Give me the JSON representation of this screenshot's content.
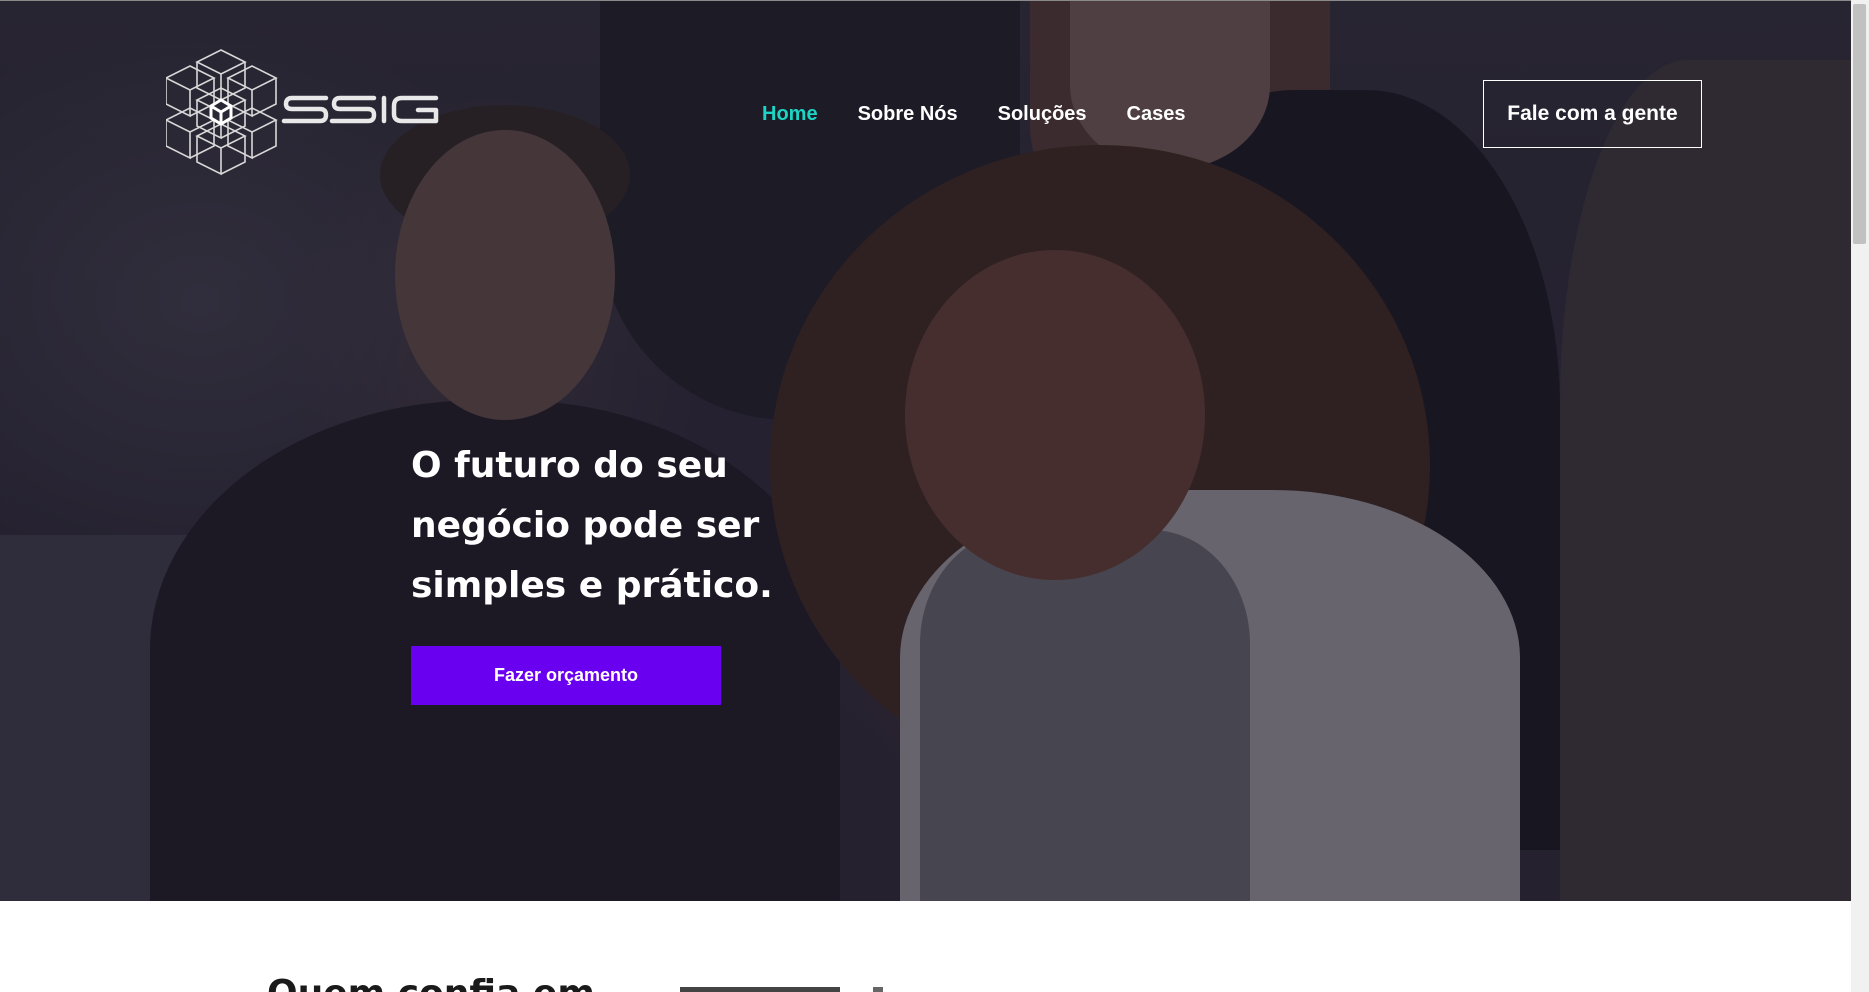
{
  "brand": {
    "name": "SSIG"
  },
  "nav": {
    "items": [
      {
        "label": "Home",
        "active": true
      },
      {
        "label": "Sobre Nós",
        "active": false
      },
      {
        "label": "Soluções",
        "active": false
      },
      {
        "label": "Cases",
        "active": false
      }
    ],
    "cta_label": "Fale com a gente"
  },
  "hero": {
    "headline": "O futuro do seu negócio pode ser simples e prático.",
    "button_label": "Fazer orçamento"
  },
  "section2": {
    "title": "Quem confia em"
  },
  "colors": {
    "accent_active": "#1ed3c4",
    "primary_button": "#6a00f0"
  }
}
